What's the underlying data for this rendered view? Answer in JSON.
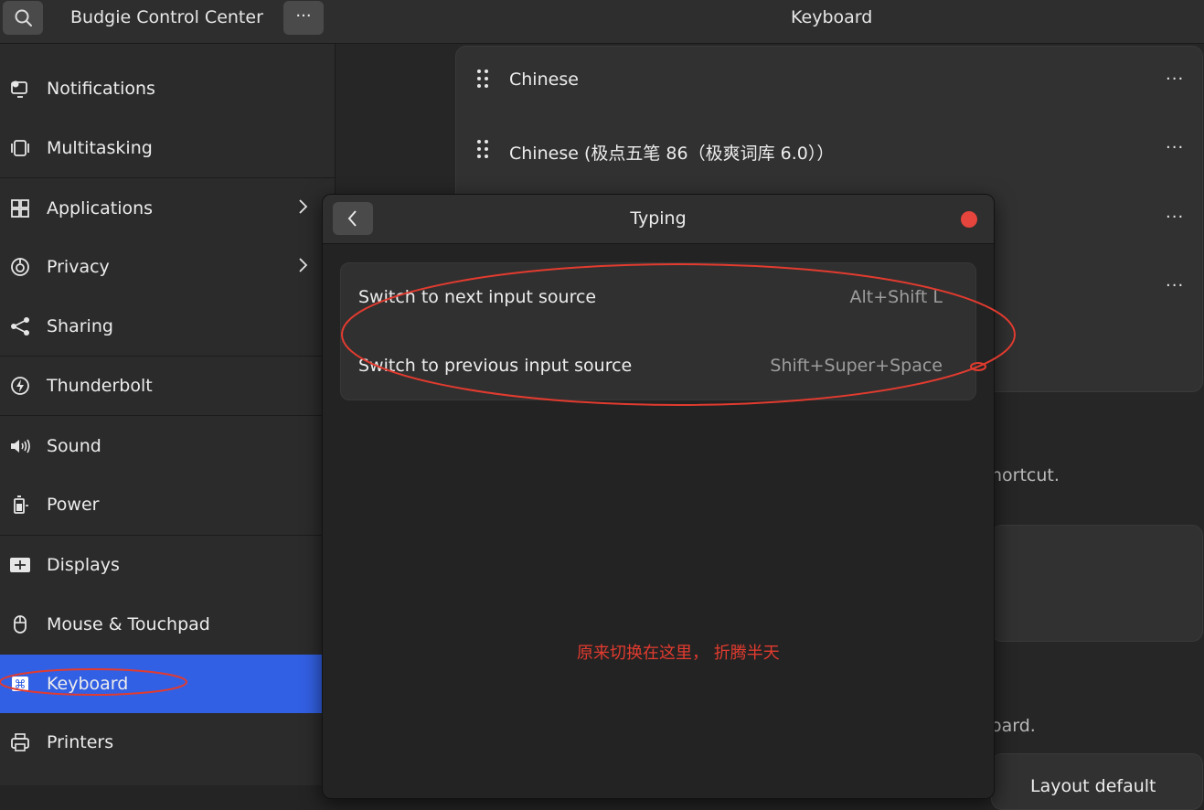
{
  "header": {
    "app_title": "Budgie Control Center",
    "page_title": "Keyboard",
    "menu_label": "···"
  },
  "sidebar": {
    "items": [
      {
        "label": "Notifications",
        "icon": "notifications-icon"
      },
      {
        "label": "Multitasking",
        "icon": "multitasking-icon"
      },
      {
        "label": "Applications",
        "icon": "applications-icon",
        "has_arrow": true
      },
      {
        "label": "Privacy",
        "icon": "privacy-icon",
        "has_arrow": true
      },
      {
        "label": "Sharing",
        "icon": "share-icon"
      },
      {
        "label": "Thunderbolt",
        "icon": "thunderbolt-icon"
      },
      {
        "label": "Sound",
        "icon": "sound-icon"
      },
      {
        "label": "Power",
        "icon": "power-icon"
      },
      {
        "label": "Displays",
        "icon": "displays-icon"
      },
      {
        "label": "Mouse & Touchpad",
        "icon": "mouse-icon"
      },
      {
        "label": "Keyboard",
        "icon": "keyboard-icon",
        "active": true
      },
      {
        "label": "Printers",
        "icon": "printer-icon"
      }
    ]
  },
  "input_sources": {
    "items": [
      {
        "label": "Chinese",
        "menu": "···"
      },
      {
        "label": "Chinese (极点五笔 86（极爽词库 6.0））",
        "menu": "···"
      },
      {
        "label": "",
        "menu": "···"
      },
      {
        "label": "",
        "menu": "···"
      }
    ]
  },
  "background": {
    "shortcut_text": "hortcut.",
    "keyboard_text": "oard.",
    "layout_text": "Layout default"
  },
  "dialog": {
    "title": "Typing",
    "shortcuts": [
      {
        "name": "Switch to next input source",
        "keys": "Alt+Shift L"
      },
      {
        "name": "Switch to previous input source",
        "keys": "Shift+Super+Space"
      }
    ],
    "annotation": "原来切换在这里， 折腾半天"
  },
  "colors": {
    "accent": "#3260e4",
    "close": "#e5453d",
    "annotation": "#e23b2f"
  }
}
